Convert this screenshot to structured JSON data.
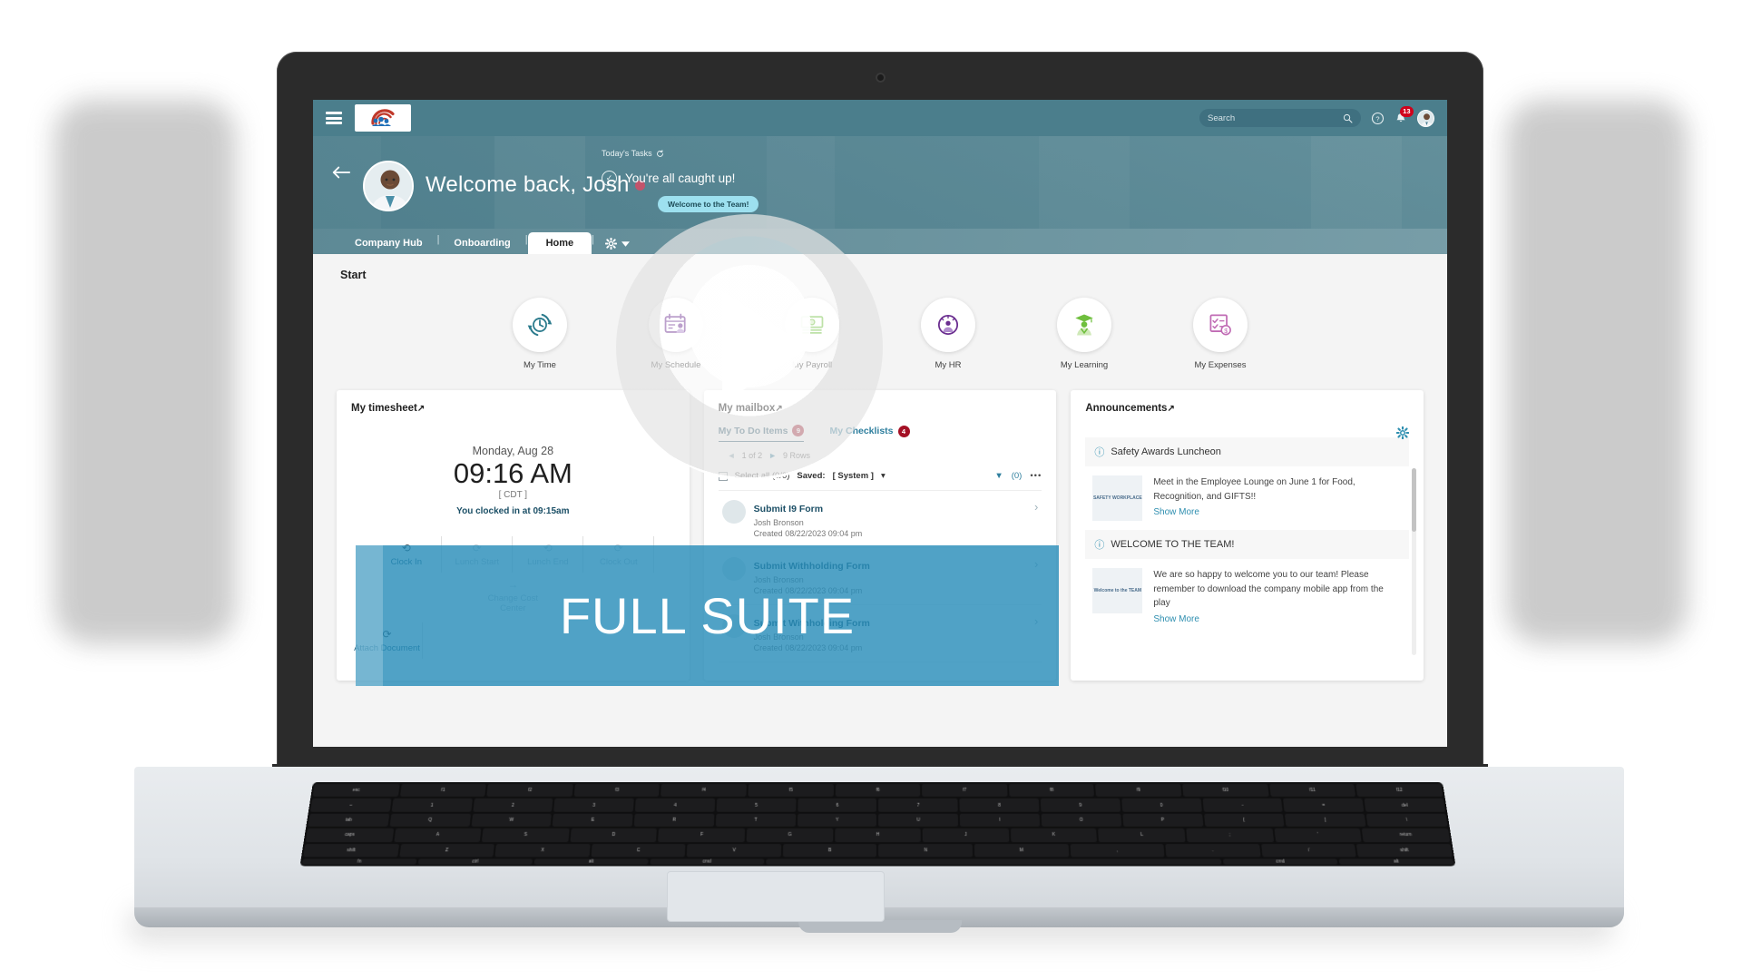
{
  "appbar": {
    "menu_icon": "hamburger-icon",
    "logo_alt": "company-logo",
    "search_placeholder": "Search",
    "search_value": "",
    "search_icon": "search-icon",
    "help_icon": "help-icon",
    "notifications_icon": "bell-icon",
    "notifications_count": "13",
    "avatar_icon": "user-avatar"
  },
  "hero": {
    "back_icon": "back-arrow-icon",
    "avatar": "profile-photo",
    "greeting": "Welcome back, Josh",
    "todays_tasks_label": "Today's Tasks",
    "refresh_icon": "refresh-icon",
    "caught_up": "You're all caught up!",
    "check_icon": "check-circle-icon",
    "team_pill": "Welcome to the Team!"
  },
  "tabs": {
    "items": [
      {
        "label": "Company Hub",
        "active": false
      },
      {
        "label": "Onboarding",
        "active": false
      },
      {
        "label": "Home",
        "active": true
      }
    ],
    "separator": "|",
    "gear_icon": "gear-icon",
    "chevron_icon": "chevron-down-icon"
  },
  "content": {
    "start_label": "Start",
    "quick_icons": [
      {
        "label": "My Time",
        "icon": "clock-refresh-icon",
        "color": "#2a7a8c"
      },
      {
        "label": "My Schedule",
        "icon": "calendar-person-icon",
        "color": "#6a2d8f"
      },
      {
        "label": "My Payroll",
        "icon": "cash-icon",
        "color": "#6fbf3e"
      },
      {
        "label": "My HR",
        "icon": "hr-gauge-person-icon",
        "color": "#6a2d8f"
      },
      {
        "label": "My Learning",
        "icon": "graduate-icon",
        "color": "#6fbf3e"
      },
      {
        "label": "My Expenses",
        "icon": "expense-receipt-icon",
        "color": "#c06bb4"
      }
    ]
  },
  "timesheet": {
    "title": "My timesheet",
    "external_icon": "↗",
    "date": "Monday, Aug 28",
    "time": "09:16 AM",
    "timezone": "[ CDT ]",
    "note": "You clocked in at 09:15am",
    "actions": [
      {
        "label": "Clock In",
        "icon": "clock-in-icon",
        "enabled": true
      },
      {
        "label": "Lunch Start",
        "icon": "lunch-start-icon",
        "enabled": false
      },
      {
        "label": "Lunch End",
        "icon": "lunch-end-icon",
        "enabled": false
      },
      {
        "label": "Clock Out",
        "icon": "clock-out-icon",
        "enabled": false
      },
      {
        "label": "Change Cost Center",
        "icon": "arrow-right-icon",
        "enabled": false
      }
    ],
    "actions_row2": [
      {
        "label": "Attach Document",
        "icon": "attach-icon",
        "enabled": true
      }
    ]
  },
  "mailbox": {
    "title": "My mailbox",
    "external_icon": "↗",
    "tabs": [
      {
        "label": "My To Do Items",
        "count": "9",
        "active": true
      },
      {
        "label": "My Checklists",
        "count": "4",
        "active": false
      }
    ],
    "pager": {
      "prev_icon": "◄",
      "page": "1 of 2",
      "next_icon": "►",
      "rows": "9 Rows"
    },
    "toolbar": {
      "select_all": "Select all (0/0)",
      "saved_label": "Saved:",
      "saved_value": "[ System ]",
      "chevron_icon": "chevron-down-icon",
      "filter_icon": "filter-icon",
      "filter_count": "(0)",
      "more_icon": "more-options-icon"
    },
    "items": [
      {
        "title": "Submit I9 Form",
        "person": "Josh Bronson",
        "meta": "Created 08/22/2023 09:04 pm"
      },
      {
        "title": "Submit Withholding Form",
        "person": "Josh Bronson",
        "meta": "Created 08/22/2023 09:04 pm"
      },
      {
        "title": "Submit Withholding Form",
        "person": "Josh Bronson",
        "meta": "Created 08/22/2023 09:04 pm"
      }
    ]
  },
  "announcements": {
    "title": "Announcements",
    "external_icon": "↗",
    "gear_icon": "gear-icon",
    "items": [
      {
        "heading": "Safety Awards Luncheon",
        "info_icon": "info-icon",
        "thumb_text": "SAFETY WORKPLACE",
        "body": "Meet in the Employee Lounge on June 1 for Food, Recognition, and GIFTS!!",
        "more": "Show More"
      },
      {
        "heading": "WELCOME TO THE TEAM!",
        "info_icon": "info-icon",
        "thumb_text": "Welcome to the TEAM",
        "body": "We are so happy to welcome you to our team! Please remember to download the company mobile app from the play",
        "more": "Show More"
      }
    ]
  },
  "overlay": {
    "banner_text": "FULL SUITE",
    "play_icon": "play-button-icon",
    "banner_color": "#298ebadd"
  },
  "device": {
    "keyboard_rows": [
      [
        "esc",
        "f1",
        "f2",
        "f3",
        "f4",
        "f5",
        "f6",
        "f7",
        "f8",
        "f9",
        "f10",
        "f11",
        "f12"
      ],
      [
        "~",
        "1",
        "2",
        "3",
        "4",
        "5",
        "6",
        "7",
        "8",
        "9",
        "0",
        "-",
        "=",
        "del"
      ],
      [
        "tab",
        "Q",
        "W",
        "E",
        "R",
        "T",
        "Y",
        "U",
        "I",
        "O",
        "P",
        "[",
        "]",
        "\\"
      ],
      [
        "caps",
        "A",
        "S",
        "D",
        "F",
        "G",
        "H",
        "J",
        "K",
        "L",
        ";",
        "'",
        "return"
      ],
      [
        "shift",
        "Z",
        "X",
        "C",
        "V",
        "B",
        "N",
        "M",
        ",",
        ".",
        "/",
        "shift"
      ],
      [
        "fn",
        "ctrl",
        "alt",
        "cmd",
        "",
        "cmd",
        "alt"
      ]
    ]
  }
}
